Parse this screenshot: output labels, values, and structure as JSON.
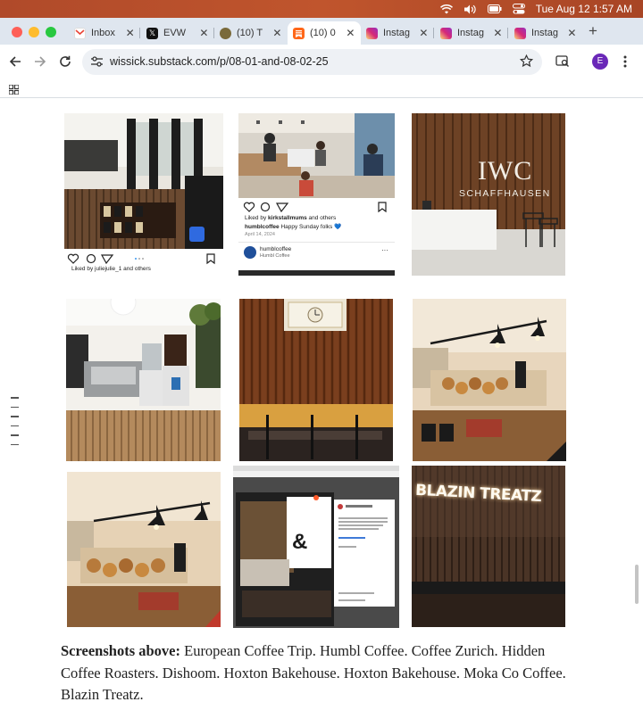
{
  "menubar": {
    "datetime": "Tue Aug 12  1:57 AM"
  },
  "tabs": [
    {
      "label": "Inbox",
      "favicon_color": "#ea4335"
    },
    {
      "label": "EVW",
      "favicon_color": "#111111"
    },
    {
      "label": "(10) T",
      "favicon_color": "#7a6a3a"
    },
    {
      "label": "(10) 0",
      "favicon_color": "#ff6719",
      "active": true
    },
    {
      "label": "Instag",
      "favicon_color": "#d6249f"
    },
    {
      "label": "Instag",
      "favicon_color": "#d6249f"
    },
    {
      "label": "Instag",
      "favicon_color": "#d6249f"
    }
  ],
  "address_bar": {
    "url": "wissick.substack.com/p/08-01-and-08-02-25"
  },
  "profile": {
    "initial": "E"
  },
  "photos": {
    "p2": {
      "liked_by": "Liked by ",
      "liker": "kirkstallmums",
      "and_others": " and others",
      "account": "humblcoffee",
      "caption": " Happy Sunday folks 💙",
      "date": "April 14, 2024",
      "profile_name": "humblcoffee",
      "profile_sub": "Humbl Coffee"
    },
    "p1": {
      "liked_by": "Liked by juliejulie_1 and others"
    },
    "p3": {
      "logo_line1": "IWC",
      "logo_line2": "SCHAFFHAUSEN"
    },
    "p9": {
      "sign": "BLAZIN TREATZ"
    },
    "p8": {
      "monogram": "&"
    }
  },
  "caption": {
    "label": "Screenshots above:",
    "text": " European Coffee Trip. Humbl Coffee. Coffee Zurich. Hidden Coffee Roasters. Dishoom. Hoxton Bakehouse. Hoxton Bakehouse. Moka Co Coffee. Blazin Treatz."
  },
  "colors": {
    "accent_menubar": "#b04a2a",
    "tabstrip": "#dfe6ef",
    "omnibox": "#eef1f5"
  }
}
